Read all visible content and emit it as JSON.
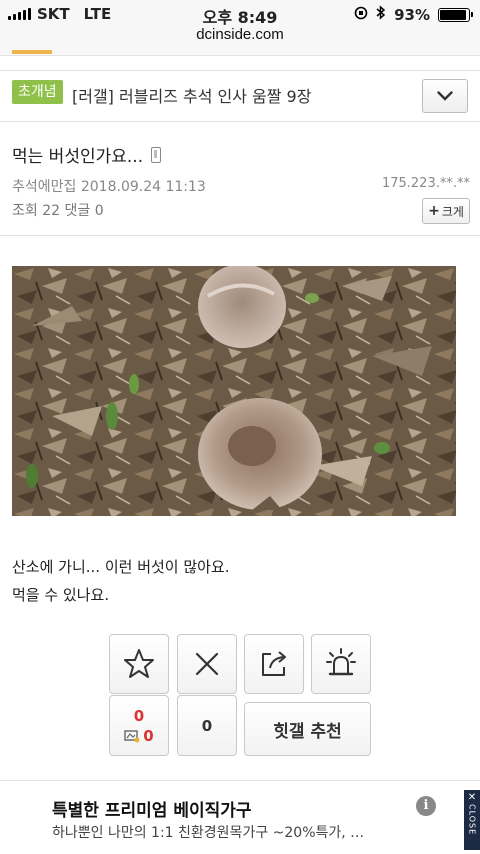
{
  "status_bar": {
    "carrier": "SKT",
    "network": "LTE",
    "time": "오후 8:49",
    "battery_percent": "93%",
    "battery_level": 0.93,
    "icons": [
      "signal-bars-icon",
      "screen-lock-icon",
      "bluetooth-icon",
      "battery-icon"
    ]
  },
  "browser": {
    "url": "dcinside.com"
  },
  "related": {
    "badge": "초개념",
    "title": "[러갤] 러블리즈 추석 인사 움짤 9장",
    "expand_icon": "chevron-down-icon"
  },
  "post": {
    "title": "먹는 버섯인가요...",
    "author": "추석에만집",
    "datetime": "2018.09.24 11:13",
    "ip": "175.223.**.**",
    "views_label": "조회",
    "views": "22",
    "comments_label": "댓글",
    "comments": "0",
    "enlarge_icon": "+",
    "enlarge_label": "크게",
    "body_lines": [
      "산소에 가니... 이런 버섯이 많아요.",
      "먹을 수 있나요."
    ]
  },
  "actions": {
    "recommend_count": "0",
    "fixed_recommend_count": "0",
    "downvote_count": "0",
    "hit_label": "힛갤 추천",
    "icons": [
      "star-icon",
      "x-icon",
      "share-icon",
      "siren-icon",
      "mobile-recommend-icon"
    ]
  },
  "ad": {
    "title": "특별한 프리미엄 베이직가구",
    "description": "하나뿐인 나만의 1:1 친환경원목가구 ~20%특가, …",
    "info_icon": "i",
    "close_label": "CLOSE"
  },
  "colors": {
    "badge_green": "#8fc14a",
    "count_red": "#dd3333",
    "ad_close_navy": "#1d2a44",
    "tab_fragment_orange": "#f0b54a"
  }
}
